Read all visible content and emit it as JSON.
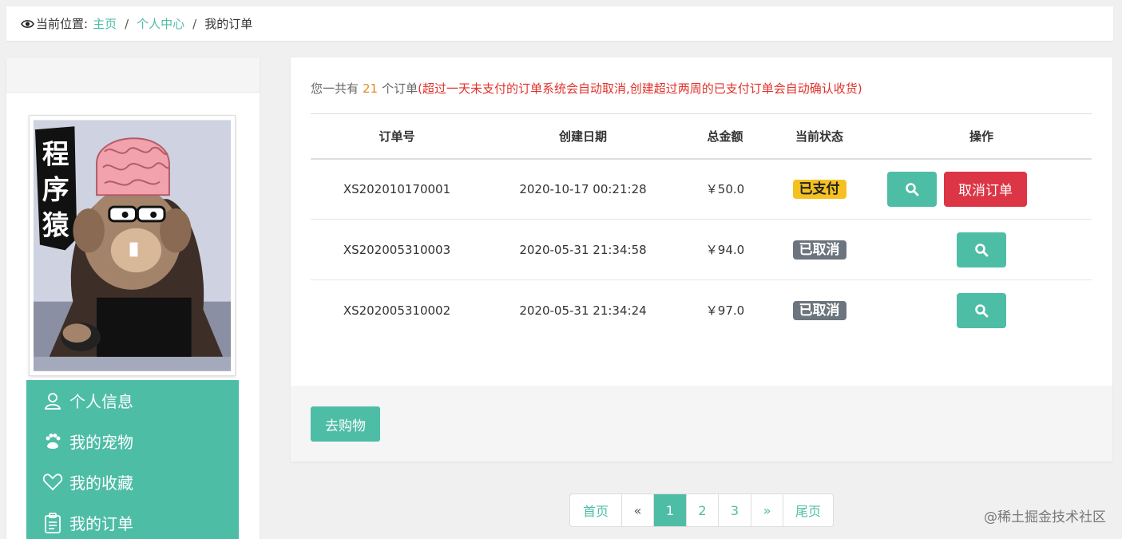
{
  "breadcrumb": {
    "prefix": "当前位置:",
    "home": "主页",
    "center": "个人中心",
    "current": "我的订单",
    "separator": "/"
  },
  "menu": [
    {
      "label": "个人信息",
      "icon": "user-icon"
    },
    {
      "label": "我的宠物",
      "icon": "paw-icon"
    },
    {
      "label": "我的收藏",
      "icon": "heart-icon"
    },
    {
      "label": "我的订单",
      "icon": "clipboard-icon"
    }
  ],
  "avatar": {
    "text": "程序猿"
  },
  "summary": {
    "prefix": "您一共有",
    "count": "21",
    "suffix": "个订单",
    "note": "(超过一天未支付的订单系统会自动取消,创建超过两周的已支付订单会自动确认收货)"
  },
  "table": {
    "headers": [
      "订单号",
      "创建日期",
      "总金额",
      "当前状态",
      "操作"
    ],
    "rows": [
      {
        "id": "XS202010170001",
        "date": "2020-10-17 00:21:28",
        "amount": "￥50.0",
        "status": "已支付",
        "status_type": "paid",
        "cancel_label": "取消订单"
      },
      {
        "id": "XS202005310003",
        "date": "2020-05-31 21:34:58",
        "amount": "￥94.0",
        "status": "已取消",
        "status_type": "cancel"
      },
      {
        "id": "XS202005310002",
        "date": "2020-05-31 21:34:24",
        "amount": "￥97.0",
        "status": "已取消",
        "status_type": "cancel"
      }
    ]
  },
  "shop_button": "去购物",
  "pager": {
    "first": "首页",
    "prev": "«",
    "pages": [
      "1",
      "2",
      "3"
    ],
    "current": "1",
    "next": "»",
    "last": "尾页"
  },
  "watermark": "@稀土掘金技术社区",
  "colors": {
    "accent": "#4ebda6",
    "danger": "#dc3545",
    "warning": "#f5c120",
    "secondary": "#6c757d"
  }
}
